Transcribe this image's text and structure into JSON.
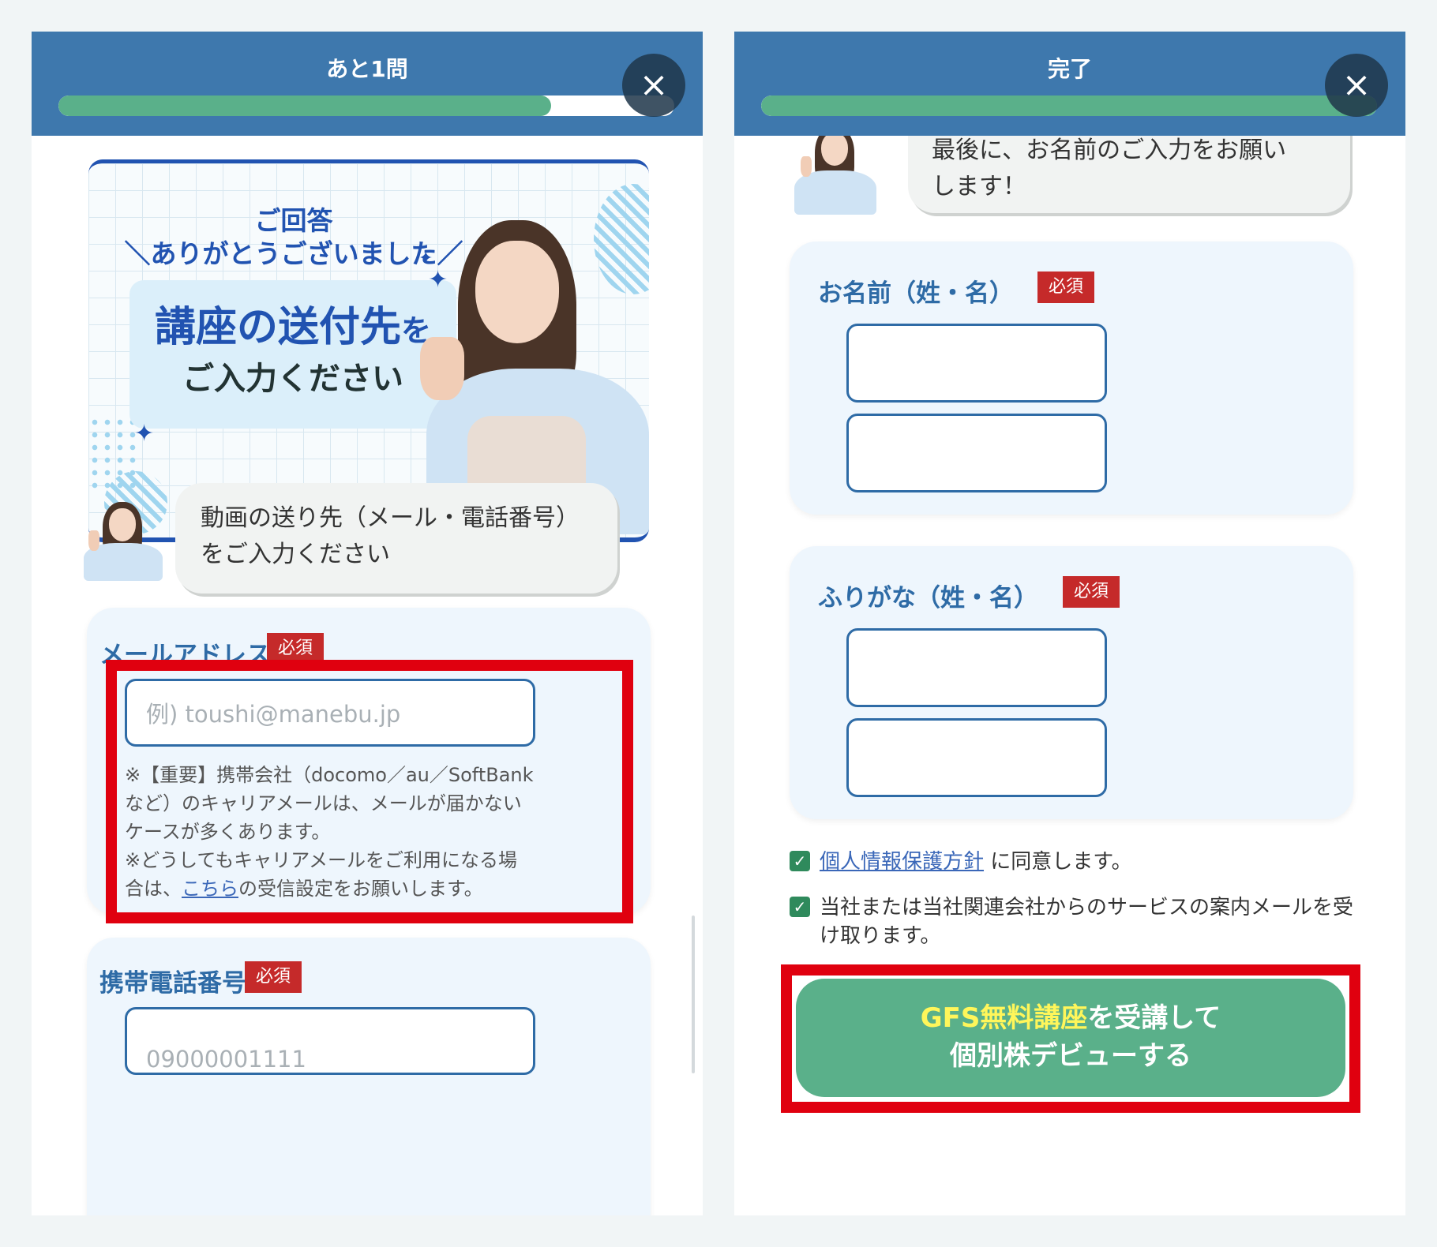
{
  "left": {
    "header_title": "あと1問",
    "progress_percent": 80,
    "close_icon": "×",
    "banner": {
      "thanks_line1": "ご回答",
      "thanks_line2": "＼ありがとうございました／",
      "main_a": "講座の送付先",
      "main_b": "を",
      "sub": "ご入力ください"
    },
    "bubble_text": "動画の送り先（メール・電話番号）をご入力ください",
    "email": {
      "label": "メールアドレス",
      "badge": "必須",
      "placeholder": "例) toushi@manebu.jp",
      "note1": "※【重要】携帯会社（docomo／au／SoftBankなど）のキャリアメールは、メールが届かないケースが多くあります。",
      "note2_a": "※どうしてもキャリアメールをご利用になる場合は、",
      "note2_link": "こちら",
      "note2_b": "の受信設定をお願いします。"
    },
    "phone": {
      "label": "携帯電話番号",
      "badge": "必須",
      "placeholder": "09000001111"
    }
  },
  "right": {
    "header_title": "完了",
    "progress_percent": 100,
    "close_icon": "×",
    "bubble_line1": "最後に、お名前のご入力をお願い",
    "bubble_line2": "します！",
    "name": {
      "label": "お名前（姓・名）",
      "badge": "必須"
    },
    "kana": {
      "label": "ふりがな（姓・名）",
      "badge": "必須"
    },
    "privacy_link": "個人情報保護方針",
    "privacy_text": "に同意します。",
    "service_text": "当社または当社関連会社からのサービスの案内メールを受け取ります。",
    "cta_yellow": "GFS無料講座",
    "cta_rest": "を受講して",
    "cta_line2": "個別株デビューする"
  },
  "colors": {
    "header": "#3e78ad",
    "progress": "#5ab08a",
    "accent_blue": "#2153b1",
    "required_badge": "#c52a2a",
    "highlight_red": "#e0000f",
    "cta_green": "#5ab08a",
    "cta_yellow_text": "#fff65a"
  }
}
